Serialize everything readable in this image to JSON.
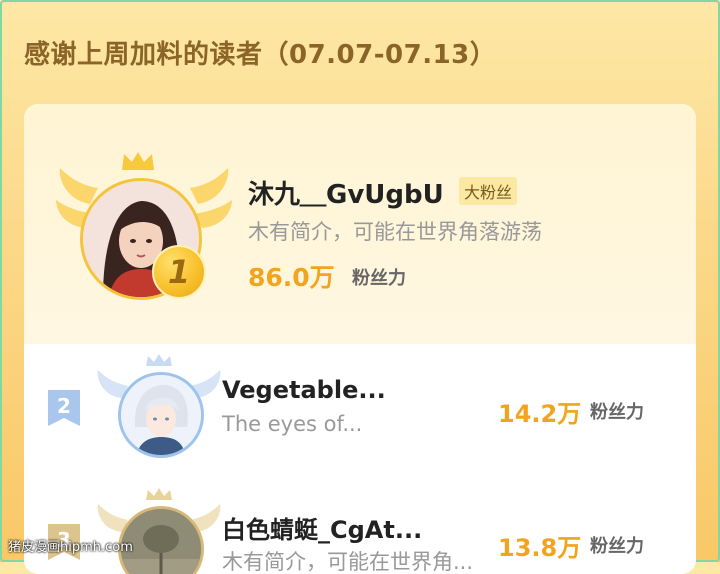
{
  "section_title": "感谢上周加料的读者（07.07-07.13）",
  "first": {
    "rank": "1",
    "name": "沐九＿GvUgbU",
    "badge": "大粉丝",
    "description": "木有简介，可能在世界角落游荡",
    "fans_count": "86.0万",
    "fans_unit": "粉丝力"
  },
  "others": [
    {
      "rank": "2",
      "name": "Vegetable...",
      "description": "The eyes of...",
      "fans_count": "14.2万",
      "fans_unit": "粉丝力"
    },
    {
      "rank": "3",
      "name": "白色蜻蜓_CgAt...",
      "description": "木有简介，可能在世界角...",
      "fans_count": "13.8万",
      "fans_unit": "粉丝力"
    }
  ],
  "watermark": "猪皮漫画hipmh.com",
  "colors": {
    "accent": "#f3a41f",
    "gold": "#f5c43b",
    "silver": "#9ec3ec",
    "bronze": "#d6b97a"
  }
}
